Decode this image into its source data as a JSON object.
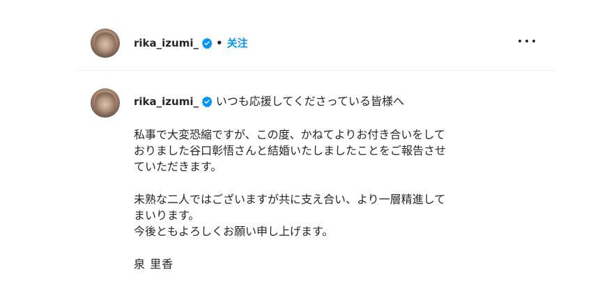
{
  "header": {
    "username": "rika_izumi_",
    "separator": "•",
    "follow_label": "关注"
  },
  "post": {
    "username": "rika_izumi_",
    "intro": "いつも応援してくださっている皆様へ",
    "paragraph1": [
      "私事で大変恐縮ですが、この度、かねてよりお付き合いをして",
      "おりました谷口彰悟さんと結婚いたしましたことをご報告させ",
      "ていただきます。"
    ],
    "paragraph2": [
      "未熟な二人ではございますが共に支え合い、より一層精進して",
      "まいります。",
      "今後ともよろしくお願い申し上げます。"
    ],
    "signature": "泉 里香"
  },
  "colors": {
    "accent": "#0095f6",
    "text": "#262626",
    "divider": "#efefef"
  },
  "icons": {
    "verified": "verified-badge-icon",
    "more": "more-options-icon"
  }
}
